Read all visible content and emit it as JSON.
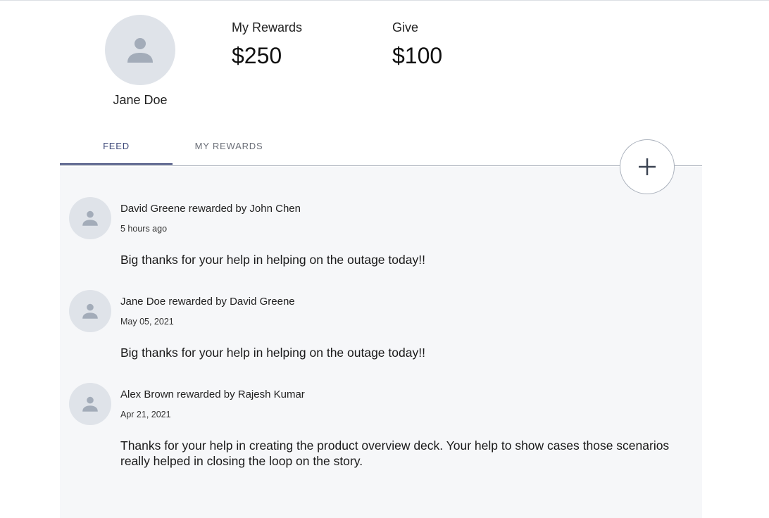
{
  "profile": {
    "name": "Jane Doe",
    "avatar_icon": "person-icon"
  },
  "stats": {
    "rewards_label": "My Rewards",
    "rewards_value": "$250",
    "give_label": "Give",
    "give_value": "$100"
  },
  "tabs": [
    {
      "label": "FEED",
      "active": true
    },
    {
      "label": "MY REWARDS",
      "active": false
    }
  ],
  "add_button": {
    "icon": "plus-icon"
  },
  "colors": {
    "accent": "#3f4a7a",
    "feed_background": "#f6f7f9",
    "avatar_background": "#dfe3e9",
    "avatar_icon": "#a3acb9"
  },
  "feed": [
    {
      "title": "David Greene rewarded by John Chen",
      "time": "5 hours ago",
      "message": "Big thanks for your help in helping on the outage today!!"
    },
    {
      "title": "Jane Doe rewarded by David Greene",
      "time": "May 05, 2021",
      "message": "Big thanks for your help in helping on the outage today!!"
    },
    {
      "title": "Alex Brown rewarded by Rajesh Kumar",
      "time": "Apr 21, 2021",
      "message": "Thanks for your help in creating the product overview deck. Your help to show cases those scenarios really helped in closing the loop on the story."
    }
  ]
}
